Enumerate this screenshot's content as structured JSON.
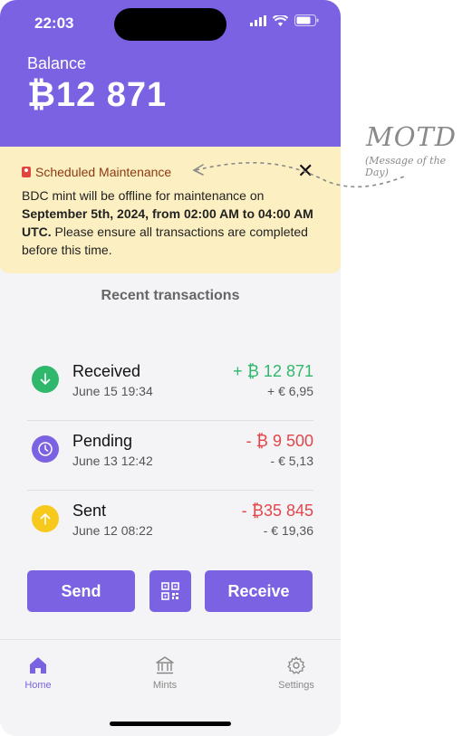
{
  "status_bar": {
    "time": "22:03"
  },
  "balance": {
    "label": "Balance",
    "amount": "₿12 871"
  },
  "motd": {
    "title": "Scheduled Maintenance",
    "close_label": "✕",
    "body_part1": "BDC mint will be offline for maintenance on ",
    "body_bold": "September 5th, 2024, from 02:00 AM to 04:00 AM UTC.",
    "body_part2": " Please ensure all transactions are completed before this time."
  },
  "transactions": {
    "title": "Recent transactions",
    "items": [
      {
        "label": "Received",
        "date": "June 15 19:34",
        "amount": "+ ₿ 12 871",
        "fiat": "+ € 6,95",
        "color": "#2fb86b",
        "icon": "arrow-down-icon"
      },
      {
        "label": "Pending",
        "date": "June 13 12:42",
        "amount": "- ₿ 9 500",
        "fiat": "- € 5,13",
        "color": "#e2464c",
        "icon": "clock-icon"
      },
      {
        "label": "Sent",
        "date": "June 12 08:22",
        "amount": "- ₿35 845",
        "fiat": "- € 19,36",
        "color": "#e2464c",
        "icon": "arrow-up-icon"
      }
    ]
  },
  "actions": {
    "send": "Send",
    "receive": "Receive"
  },
  "tabs": [
    {
      "label": "Home",
      "active": true
    },
    {
      "label": "Mints",
      "active": false
    },
    {
      "label": "Settings",
      "active": false
    }
  ],
  "annotation": {
    "title": "MOTD",
    "subtitle": "(Message of the Day)"
  },
  "colors": {
    "accent": "#7b62e3",
    "motd_bg": "#fcf0c3",
    "positive": "#2fb86b",
    "negative": "#e2464c"
  }
}
